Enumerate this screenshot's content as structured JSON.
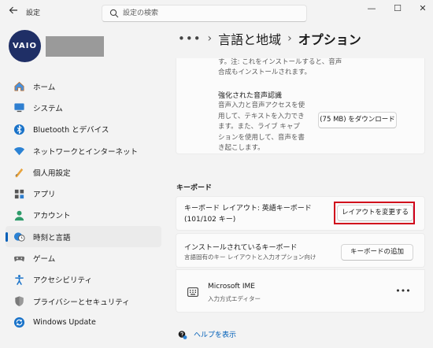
{
  "window": {
    "title": "設定",
    "back_icon": "back-arrow-icon",
    "minimize_glyph": "—",
    "maximize_glyph": "☐",
    "close_glyph": "✕"
  },
  "search": {
    "placeholder": "設定の検索"
  },
  "profile": {
    "avatar_text": "VAIO"
  },
  "sidebar": {
    "items": [
      {
        "label": "ホーム",
        "icon": "home-icon"
      },
      {
        "label": "システム",
        "icon": "system-icon"
      },
      {
        "label": "Bluetooth とデバイス",
        "icon": "bluetooth-icon"
      },
      {
        "label": "ネットワークとインターネット",
        "icon": "network-icon"
      },
      {
        "label": "個人用設定",
        "icon": "personalization-icon"
      },
      {
        "label": "アプリ",
        "icon": "apps-icon"
      },
      {
        "label": "アカウント",
        "icon": "account-icon"
      },
      {
        "label": "時刻と言語",
        "icon": "time-language-icon",
        "active": true
      },
      {
        "label": "ゲーム",
        "icon": "gaming-icon"
      },
      {
        "label": "アクセシビリティ",
        "icon": "accessibility-icon"
      },
      {
        "label": "プライバシーとセキュリティ",
        "icon": "privacy-icon"
      },
      {
        "label": "Windows Update",
        "icon": "windows-update-icon"
      }
    ]
  },
  "breadcrumb": {
    "more": "•••",
    "sep1": "›",
    "parent": "言語と地域",
    "sep2": "›",
    "current": "オプション"
  },
  "speech": {
    "cut_text": "す。注: これをインストールすると、音声合成もインストールされます。",
    "title": "強化された音声認識",
    "desc": "音声入力と音声アクセスを使用して、テキストを入力できます。また、ライブ キャプションを使用して、音声を書き起こします。",
    "download_button": "(75 MB) をダウンロード"
  },
  "keyboard": {
    "section_label": "キーボード",
    "layout_text": "キーボード レイアウト: 英語キーボード (101/102 キー)",
    "change_button": "レイアウトを変更する",
    "installed_title": "インストールされているキーボード",
    "installed_sub": "言語固有のキー レイアウトと入力オプション向け",
    "add_button": "キーボードの追加",
    "ime_title": "Microsoft IME",
    "ime_sub": "入力方式エディター",
    "ime_more": "•••"
  },
  "help": {
    "link": "ヘルプを表示"
  },
  "colors": {
    "accent": "#005fb8",
    "highlight": "#d0021b",
    "avatar": "#1f2f66"
  }
}
